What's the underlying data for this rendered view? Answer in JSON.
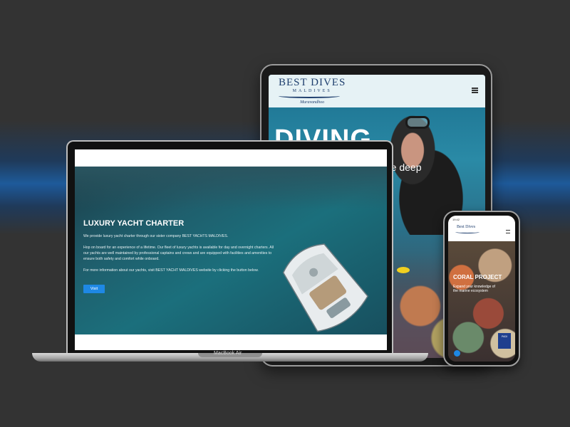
{
  "tablet": {
    "logo_top": "BEST DIVES",
    "logo_mid": "MALDIVES",
    "logo_sub": "Muravandhoo",
    "hero_title": "DIVING",
    "hero_subtitle": "the deep"
  },
  "laptop": {
    "brand": "MacBook Air",
    "section_title": "LUXURY YACHT CHARTER",
    "paragraph_1": "We provide luxury yacht charter through our sister company BEST YACHTS MALDIVES.",
    "paragraph_2": "Hop on board for an experience of a lifetime. Our fleet of luxury yachts is available for day and overnight charters. All our yachts are well maintained by professional captains and crews and are equipped with facilities and amenities to ensure both safety and comfort while onboard.",
    "paragraph_3": "For more information about our yachts, visit BEST YACHT MALDIVES website by clicking the button below.",
    "visit_button": "Visit"
  },
  "phone": {
    "status_time": "19:42",
    "logo": "Best Dives",
    "hero_title": "CORAL PROJECT",
    "hero_text": "Expand your knowledge of the marine ecosystem",
    "badge_text": "PADI"
  }
}
